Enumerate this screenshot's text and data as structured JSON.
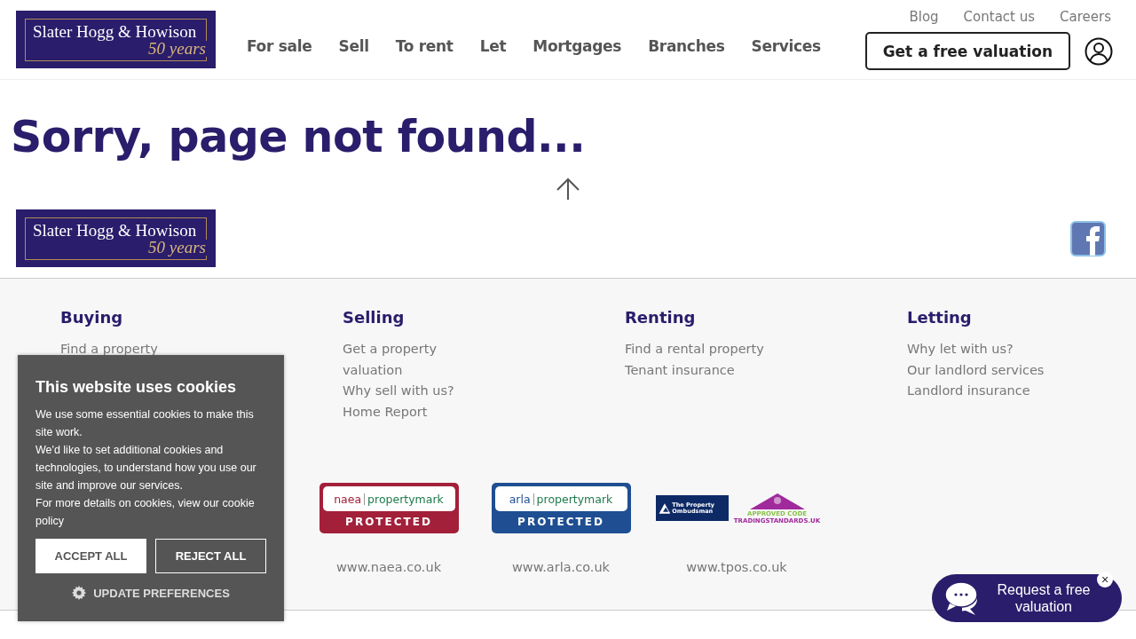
{
  "logo": {
    "name": "Slater Hogg & Howison",
    "tagline": "50 years"
  },
  "top_links": [
    "Blog",
    "Contact us",
    "Careers"
  ],
  "nav": [
    "For sale",
    "Sell",
    "To rent",
    "Let",
    "Mortgages",
    "Branches",
    "Services"
  ],
  "cta_button": "Get a free valuation",
  "heading": "Sorry, page not found...",
  "footer_logo": {
    "name": "Slater Hogg & Howison",
    "tagline": "50 years"
  },
  "footer_columns": [
    {
      "title": "Buying",
      "links": [
        "Find a property"
      ]
    },
    {
      "title": "Selling",
      "links": [
        "Get a property valuation",
        "Why sell with us?",
        "Home Report"
      ]
    },
    {
      "title": "Renting",
      "links": [
        "Find a rental property",
        "Tenant insurance"
      ]
    },
    {
      "title": "Letting",
      "links": [
        "Why let with us?",
        "Our landlord services",
        "Landlord insurance"
      ]
    }
  ],
  "accreditations": [
    {
      "kind": "propertymark",
      "org": "naea",
      "brand": "propertymark",
      "status": "PROTECTED",
      "color": "#a3203a",
      "url": "www.naea.co.uk"
    },
    {
      "kind": "propertymark",
      "org": "arla",
      "brand": "propertymark",
      "status": "PROTECTED",
      "color": "#1f4f92",
      "url": "www.arla.co.uk"
    },
    {
      "kind": "ombudsman",
      "org": "The Property Ombudsman",
      "badge": "APPROVED CODE",
      "badge_sub": "TRADINGSTANDARDS.UK",
      "url": "www.tpos.co.uk"
    }
  ],
  "cookie_banner": {
    "title": "This website uses cookies",
    "paragraphs": [
      "We use some essential cookies to make this site work.",
      "We'd like to set additional cookies and technologies, to understand how you use our site and improve our services.",
      "For more details on cookies, view our cookie policy"
    ],
    "accept": "ACCEPT ALL",
    "reject": "REJECT ALL",
    "preferences": "UPDATE PREFERENCES"
  },
  "chat_widget": {
    "label": "Request a free valuation",
    "close": "×"
  }
}
